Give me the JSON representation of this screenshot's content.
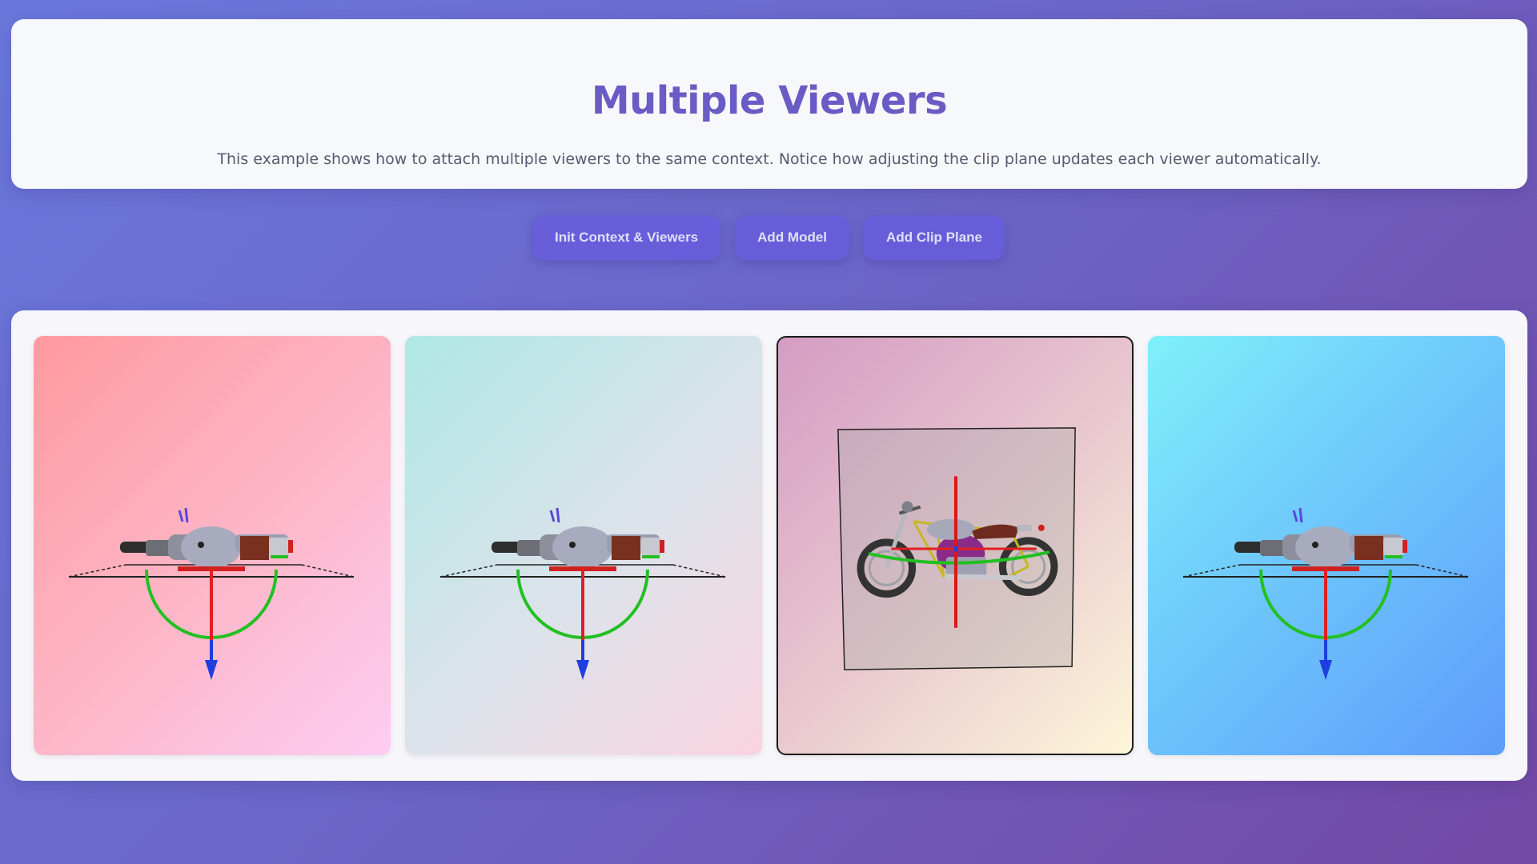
{
  "header": {
    "title": "Multiple Viewers",
    "description": "This example shows how to attach multiple viewers to the same context. Notice how adjusting the clip plane updates each viewer automatically."
  },
  "toolbar": {
    "init_label": "Init Context & Viewers",
    "add_model_label": "Add Model",
    "add_clip_plane_label": "Add Clip Plane"
  },
  "viewers": [
    {
      "view": "top",
      "background": [
        "#ff9a9e",
        "#fdcdf2"
      ]
    },
    {
      "view": "top",
      "background": [
        "#aee8e5",
        "#f9d4df"
      ]
    },
    {
      "view": "side-clip-plane",
      "selected": true,
      "background": [
        "#d59cc3",
        "#fdf6d8"
      ]
    },
    {
      "view": "top",
      "background": [
        "#7ff1fa",
        "#5d9cfb"
      ]
    }
  ],
  "colors": {
    "accent": "#6a5cc4",
    "axis_x": "#e02020",
    "axis_y": "#22c022",
    "axis_z": "#1f3ee0"
  }
}
